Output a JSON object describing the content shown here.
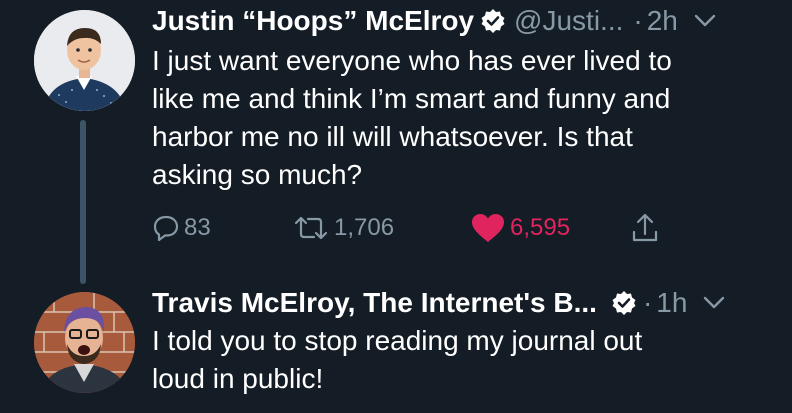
{
  "tweets": [
    {
      "name": "Justin “Hoops” McElroy",
      "handle": "@Justi...",
      "dot": "·",
      "time": "2h",
      "text": "I just want everyone who has ever lived to\nlike me and think I’m smart and funny and\nharbor me no ill will whatsoever. Is that\nasking so much?",
      "replies": "83",
      "retweets": "1,706",
      "likes": "6,595",
      "liked": true,
      "verified": true
    },
    {
      "name": "Travis McElroy, The Internet's B...",
      "dot": "·",
      "time": "1h",
      "text": "I told you to stop reading my journal out\nloud in public!",
      "verified": true
    }
  ],
  "colors": {
    "background": "#141c26",
    "secondary_text": "#8899a6",
    "like": "#e0245e",
    "thread_line": "#3d5466"
  },
  "icons": [
    "reply-icon",
    "retweet-icon",
    "heart-icon",
    "share-icon",
    "verified-badge-icon",
    "chevron-down-icon"
  ]
}
